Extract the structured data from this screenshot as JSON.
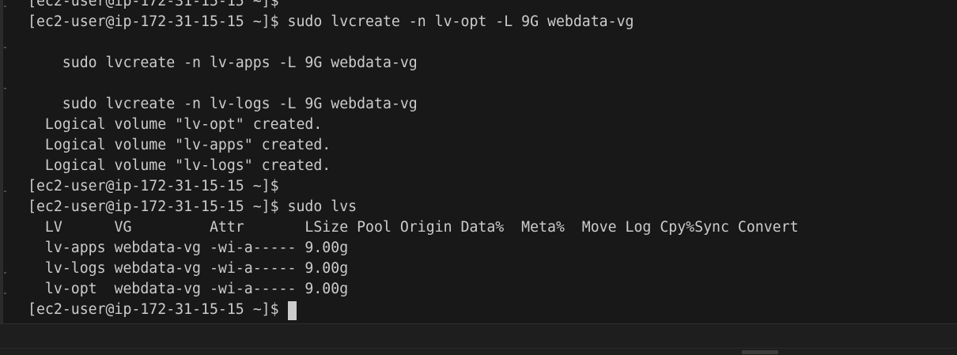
{
  "terminal": {
    "lines": [
      "[ec2-user@ip-172-31-15-15 ~]$",
      "[ec2-user@ip-172-31-15-15 ~]$ sudo lvcreate -n lv-opt -L 9G webdata-vg",
      "",
      "    sudo lvcreate -n lv-apps -L 9G webdata-vg",
      "",
      "    sudo lvcreate -n lv-logs -L 9G webdata-vg",
      "  Logical volume \"lv-opt\" created.",
      "  Logical volume \"lv-apps\" created.",
      "  Logical volume \"lv-logs\" created.",
      "[ec2-user@ip-172-31-15-15 ~]$",
      "[ec2-user@ip-172-31-15-15 ~]$ sudo lvs",
      "  LV      VG         Attr       LSize Pool Origin Data%  Meta%  Move Log Cpy%Sync Convert",
      "  lv-apps webdata-vg -wi-a----- 9.00g",
      "  lv-logs webdata-vg -wi-a----- 9.00g",
      "  lv-opt  webdata-vg -wi-a----- 9.00g",
      "[ec2-user@ip-172-31-15-15 ~]$ "
    ]
  },
  "colors": {
    "background": "#181818",
    "text": "#cccccc",
    "cursor": "#cccccc"
  }
}
